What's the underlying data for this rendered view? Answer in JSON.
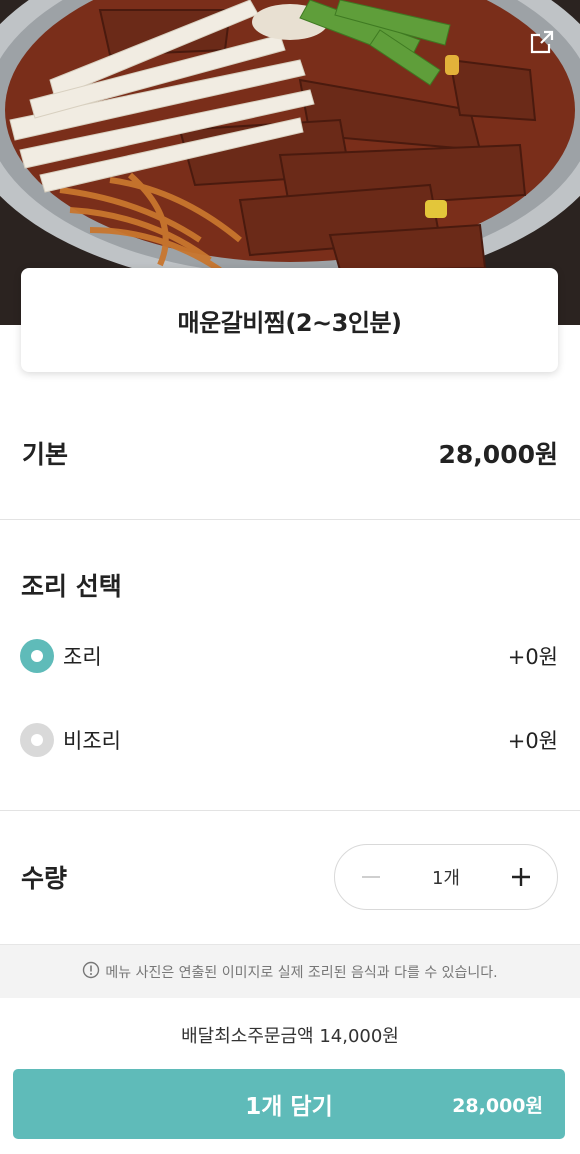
{
  "hero": {
    "image_alt": "spicy braised short ribs with mushrooms, noodles and green onion"
  },
  "menu": {
    "title": "매운갈비찜(2~3인분)"
  },
  "base": {
    "label": "기본",
    "price": "28,000원"
  },
  "cooking": {
    "title": "조리 선택",
    "options": [
      {
        "label": "조리",
        "price": "+0원",
        "selected": true
      },
      {
        "label": "비조리",
        "price": "+0원",
        "selected": false
      }
    ]
  },
  "quantity": {
    "label": "수량",
    "value": "1개"
  },
  "notice": {
    "text": "메뉴 사진은 연출된 이미지로 실제 조리된 음식과 다를 수 있습니다."
  },
  "footer": {
    "min_order": "배달최소주문금액 14,000원",
    "cta_label": "1개 담기",
    "cta_price": "28,000원"
  },
  "colors": {
    "accent": "#5fbbb9",
    "radio_off": "#d9d9d9",
    "divider": "#e3e3e3"
  }
}
